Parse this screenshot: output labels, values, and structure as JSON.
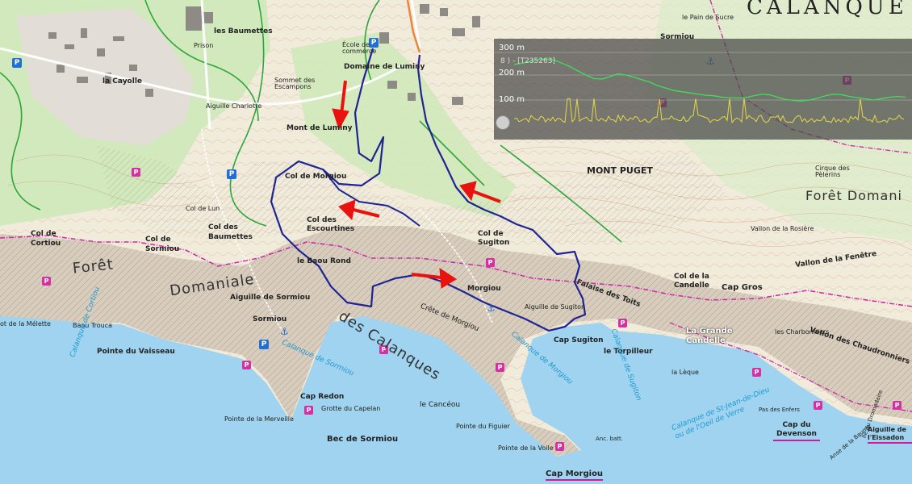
{
  "map": {
    "title_fragment": "CALANQUE",
    "labels": {
      "les_baumettes": "les Baumettes",
      "prison": "Prison",
      "la_cayolle": "la Cayolle",
      "domaine_de_luminy": "Domaine de Luminy",
      "ecole_de_commerce": "École de commerce",
      "sommet_escampons": "Sommet des Escampons",
      "aiguille_charlotte": "Aiguille Charlotte",
      "mont_de_luminy": "Mont de Luminy",
      "col_de_morgiou": "Col de Morgiou",
      "col_des_escourtines": "Col des Escourtines",
      "col_de_lun": "Col de Lun",
      "col_des_baumettes": "Col des Baumettes",
      "col_de_cortiou": "Col de Cortiou",
      "col_de_sormiou": "Col de Sormiou",
      "le_baou_rond": "le Baou Rond",
      "aiguille_de_sormiou": "Aiguille de Sormiou",
      "sormiou": "Sormiou",
      "foret": "Forêt",
      "domaniale": "Domaniale",
      "calanques": "des Calanques",
      "baou_trouca": "Baou Trouca",
      "pointe_du_vaisseau": "Pointe du Vaisseau",
      "cap_redon": "Cap Redon",
      "grotte_du_capelan": "Grotte du Capelan",
      "pointe_de_la_merveille": "Pointe de la Merveille",
      "bec_de_sormiou": "Bec de Sormiou",
      "calanque_de_sormiou": "Calanque de Sormiou",
      "calanque_de_cortiou": "Calanque de Cortiou",
      "la_melette": "ot de la Mélette",
      "crete_de_morgiou": "Crête de Morgiou",
      "morgiou": "Morgiou",
      "le_canceou": "le Cancéou",
      "pointe_du_figuier": "Pointe du Figuier",
      "pointe_de_la_voile": "Pointe de la Voile",
      "cap_morgiou": "Cap Morgiou",
      "anc_batt": "Anc. batt.",
      "calanque_de_morgiou": "Calanque de Morgiou",
      "col_de_sugiton": "Col de Sugiton",
      "aiguille_de_sugiton": "Aiguille de Sugiton",
      "falaise_des_toits": "Falaise des Toits",
      "cap_sugiton": "Cap Sugiton",
      "le_torpilleur": "le Torpilleur",
      "calanque_de_sugiton": "Calanque de Sugiton",
      "la_leque": "la Lèque",
      "mont_puget": "MONT PUGET",
      "col_de_la_candelle": "Col de la Candelle",
      "la_grande_candelle": "La Grande Candelle",
      "cap_gros": "Cap Gros",
      "les_charbonniers": "les Charbonniers",
      "vallon_chaudronniers": "Vallon des Chaudronniers",
      "cap_du_devenson": "Cap du Devenson",
      "aiguille_eissadon": "Aiguille de l'Eissadon",
      "calanque_saint_jean": "Calanque de St-Jean-de-Dieu ou de l'Oeil de Verre",
      "foret_domaniale_right": "Forêt Domani",
      "cirque_pelerins": "Cirque des Pèlerins",
      "vallon_rosiere": "Vallon de la Rosière",
      "vallon_fenetre": "Vallon de la Fenêtre",
      "pain_de_sucre": "le Pain de Sucre",
      "sormiou_top": "Sormiou",
      "ile_dromadaire": "Île du Dromadaire",
      "anse_baume": "Anse de la Baume",
      "pas_enfers": "Pas des Enfers"
    }
  },
  "profile": {
    "y_labels": [
      "300 m",
      "200 m",
      "100 m"
    ],
    "track_name": "8 ) - [T235263]",
    "elevation": [
      250,
      255,
      262,
      270,
      272,
      268,
      255,
      240,
      222,
      205,
      190,
      188,
      198,
      210,
      205,
      196,
      185,
      175,
      160,
      150,
      140,
      135,
      130,
      125,
      120,
      118,
      112,
      110,
      108,
      110,
      118,
      124,
      122,
      112,
      102,
      98,
      96,
      100,
      108,
      118,
      125,
      122,
      115,
      110,
      105,
      100,
      106,
      112,
      115,
      112
    ]
  },
  "colors": {
    "route": "#1e2593",
    "arrow": "#e8130f",
    "sea": "#9fd3ef",
    "forest": "#cfe9b9",
    "terrain": "#f1ebdc",
    "boundary": "#cc2ea8",
    "trail": "#2ea63a"
  },
  "icons": [
    "poi-icon",
    "parking-icon",
    "anchor-icon"
  ]
}
